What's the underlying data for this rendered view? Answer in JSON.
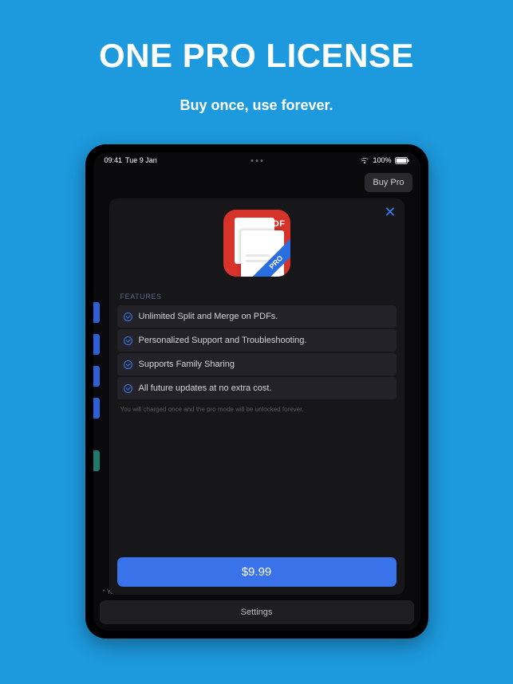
{
  "marketing": {
    "headline": "ONE PRO LICENSE",
    "subhead": "Buy once, use forever."
  },
  "status_bar": {
    "time": "09:41",
    "date": "Tue 9 Jan",
    "battery_pct": "100%"
  },
  "nav": {
    "buy_pro_label": "Buy Pro"
  },
  "background": {
    "truncated_text": "* Yo",
    "settings_label": "Settings"
  },
  "app_icon": {
    "tag": "PDF",
    "ribbon": "PRO"
  },
  "modal": {
    "section_label": "FEATURES",
    "features": [
      "Unlimited Split and Merge on PDFs.",
      "Personalized Support and Troubleshooting.",
      "Supports Family Sharing",
      "All future updates at no extra cost."
    ],
    "fine_print": "You will charged once and the pro mode will be unlocked forever.",
    "price_label": "$9.99"
  }
}
